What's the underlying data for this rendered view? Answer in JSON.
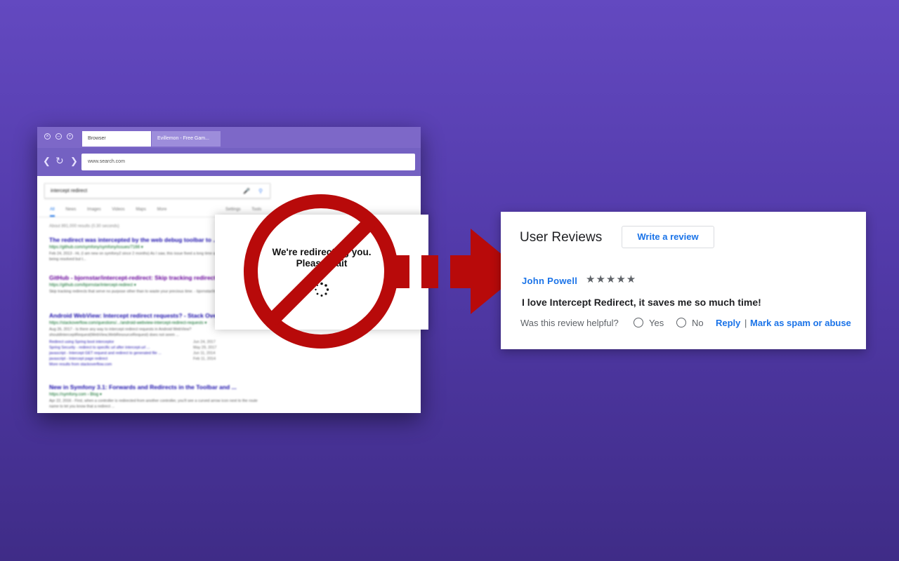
{
  "colors": {
    "background_top": "#6349c0",
    "background_bottom": "#3f2c87",
    "browser_chrome": "#7461c2",
    "prohibition_red": "#b80a0a",
    "link_blue": "#1a73e8"
  },
  "browser": {
    "window_controls": [
      "close-icon",
      "minimize-icon",
      "maximize-icon"
    ],
    "tabs": [
      {
        "label": "Browser"
      },
      {
        "label": "Evillemon - Free Gam..."
      }
    ],
    "nav_icons": [
      "back-arrow-icon",
      "reload-icon",
      "forward-arrow-icon"
    ],
    "address": "www.search.com",
    "search": {
      "query": "intercept redirect",
      "icons": [
        "microphone-icon",
        "search-icon"
      ],
      "tabs": [
        "All",
        "News",
        "Images",
        "Videos",
        "Maps",
        "More"
      ],
      "tools": [
        "Settings",
        "Tools"
      ],
      "result_count": "About 891,000 results (0.30 seconds)",
      "results": [
        {
          "title": "The redirect was intercepted by the web debug toolbar to ...",
          "url": "https://github.com/symfony/symfony/issues/7166 ▾",
          "snippet": "Feb 24, 2013 - Hi, (I am new on symfony2 since 2 months) As I saw, this issue fixed a long time ago, and it was believed being resolved but t..."
        },
        {
          "title": "GitHub - bjornstar/intercept-redirect: Skip tracking redirects ...",
          "url": "https://github.com/bjornstar/intercept-redirect ▾",
          "snippet": "Skip tracking redirects that serve no purpose other than to waste your precious time. - bjornstar/intercept-redirect."
        },
        {
          "title": "Android WebView: Intercept redirect requests? - Stack Overflow",
          "url": "https://stackoverflow.com/questions/.../android-webview-intercept-redirect-requests ▾",
          "snippet": "Aug 26, 2017 - Is there any way to intercept redirect requests in Android WebView? shouldInterceptRequest(WebView,WebResourceRequest) does not seem ...",
          "sublinks": [
            {
              "text": "Redirect using Spring boot interceptor",
              "date": "Jun 24, 2017"
            },
            {
              "text": "Spring Security - redirect to specific url after intercept-url ...",
              "date": "May 29, 2017"
            },
            {
              "text": "javascript - Intercept GET request and redirect to generated file ...",
              "date": "Jun 11, 2014"
            },
            {
              "text": "javascript - Intercept page redirect",
              "date": "Feb 11, 2014"
            },
            {
              "text": "More results from stackoverflow.com",
              "date": ""
            }
          ]
        },
        {
          "title": "New in Symfony 3.1: Forwards and Redirects in the Toolbar and ...",
          "url": "https://symfony.com › Blog ▾",
          "snippet": "Apr 22, 2016 - First, when a controller is redirected from another controller, you'll see a curved arrow icon next to the route name to let you know that a redirect ..."
        }
      ]
    }
  },
  "redirect_popup": {
    "message": "We're redirecting you.\nPlease wait",
    "spinner_icon": "loading-spinner-icon"
  },
  "overlay": {
    "prohibition_icon": "no-entry-prohibition-icon",
    "arrow_icon": "dashed-right-arrow-icon"
  },
  "reviews": {
    "title": "User Reviews",
    "write_button": "Write a review",
    "author": "John Powell",
    "rating": 5,
    "stars_text": "★★★★★",
    "text": "I love Intercept Redirect, it saves me so much time!",
    "helpful_question": "Was this review helpful?",
    "yes_label": "Yes",
    "no_label": "No",
    "reply_label": "Reply",
    "separator": "|",
    "spam_label": "Mark as spam or abuse"
  }
}
